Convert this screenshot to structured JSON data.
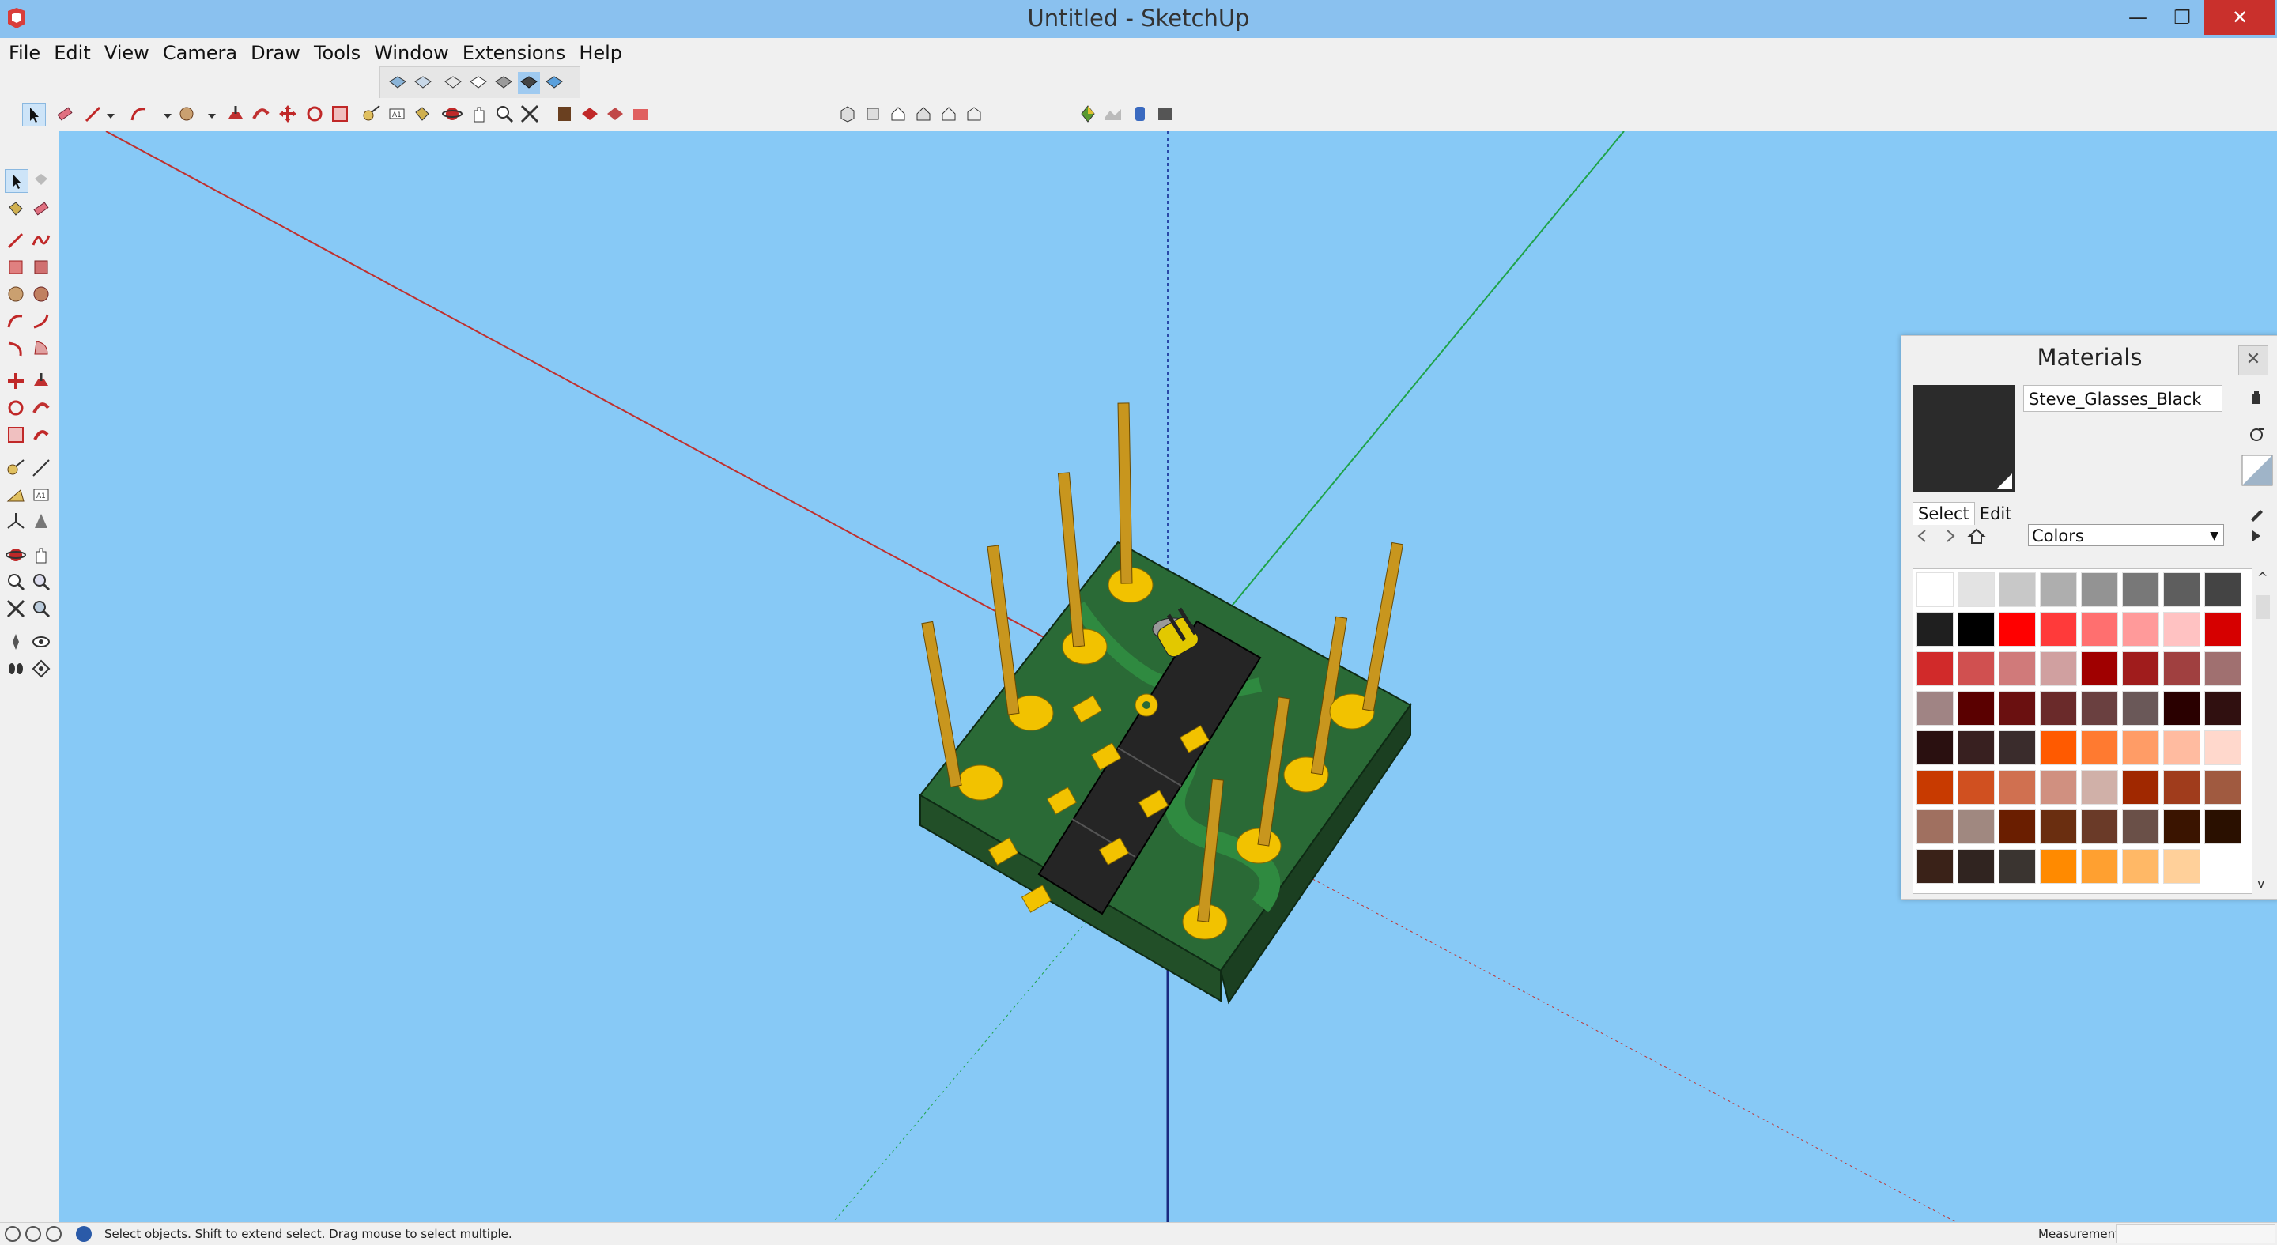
{
  "window": {
    "title": "Untitled - SketchUp",
    "minimize": "—",
    "restore": "❐",
    "close": "✕"
  },
  "menu": [
    "File",
    "Edit",
    "View",
    "Camera",
    "Draw",
    "Tools",
    "Window",
    "Extensions",
    "Help"
  ],
  "status": {
    "hint": "Select objects. Shift to extend select. Drag mouse to select multiple.",
    "measurements_label": "Measurements",
    "measurements_value": ""
  },
  "materials": {
    "title": "Materials",
    "close": "✕",
    "current_name": "Steve_Glasses_Black",
    "current_color": "#2b2b2b",
    "tabs": [
      "Select",
      "Edit"
    ],
    "collection": "Colors",
    "swatches": [
      "#ffffff",
      "#e3e3e3",
      "#c8c8c8",
      "#aeaeae",
      "#939393",
      "#787878",
      "#5e5e5e",
      "#444444",
      "#1f1f1f",
      "#000000",
      "#ff0000",
      "#ff3a3a",
      "#ff6f6f",
      "#ff9a9a",
      "#ffc2c2",
      "#d60000",
      "#d12a2a",
      "#d05050",
      "#d07a7a",
      "#d0a0a0",
      "#a00000",
      "#a01c1c",
      "#a04040",
      "#a07070",
      "#a08484",
      "#5a0000",
      "#6a1010",
      "#6a2a2a",
      "#6a4040",
      "#6a5858",
      "#2a0000",
      "#301010",
      "#2a1010",
      "#382020",
      "#3a2c2c",
      "#ff5a00",
      "#ff7a30",
      "#ff9c66",
      "#ffbba0",
      "#ffd8cc",
      "#c83a00",
      "#d05020",
      "#d07050",
      "#d09080",
      "#d0b0a8",
      "#a02800",
      "#a03c1c",
      "#a05a40",
      "#a07060",
      "#a08880",
      "#6a1e00",
      "#6a2e10",
      "#6a3a28",
      "#6a5048",
      "#3a1400",
      "#2a1000",
      "#3a2218",
      "#302420",
      "#3a3430",
      "#ff8a00",
      "#ffa030",
      "#ffb866",
      "#ffd09a"
    ]
  },
  "viewport": {
    "background": "#87c9f6"
  }
}
